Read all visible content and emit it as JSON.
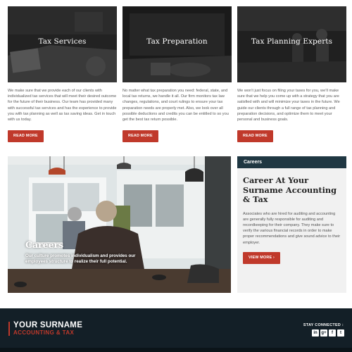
{
  "services": [
    {
      "title": "Tax Services",
      "text": "We make sure that we provide each of our clients with individualized tax services that will meet their desired outcome for the future of their business. Our team has provided many with successful tax services and has the experience to provide you with tax planning as well as tax saving ideas. Get in touch with us today.",
      "button": "READ MORE"
    },
    {
      "title": "Tax Preparation",
      "text": "No matter what tax preparation you need: federal, state, and local tax returns, we handle it all. Our firm monitors tax law changes, regulations, and court rulings to ensure your tax preparation needs are properly met. Also, we look over all possible deductions and credits you can be entitled to so you get the best tax return possible.",
      "button": "READ MORE"
    },
    {
      "title": "Tax Planning Experts",
      "text": "We won’t just focus on filing your taxes for you, we’ll make sure that we help you come up with a strategy that you are satisfied with and will minimize your taxes in the future. We guide our clients through a full range of tax planning and preparation decisions, and optimize them to meet your personal and business goals.",
      "button": "READ MORE"
    }
  ],
  "careers_feature": {
    "heading": "Careers",
    "text": "Our culture promotes individualism and provides our employees structure to realize their full potential."
  },
  "careers_panel": {
    "header": "Careers",
    "title": "Career At Your Surname Accounting & Tax",
    "text": "Associates who are hired for auditing and accounting are generally fully responsible for auditing and recordkeeping for their company. They make sure to verify the various financial records in order to make proper recommendations and give sound advice to their employer.",
    "button": "VIEW MORE ›"
  },
  "footer": {
    "logo_line1": "YOUR SURNAME",
    "logo_line2": "ACCOUNTING & TAX",
    "stay_connected": "STAY CONNECTED :",
    "social": [
      {
        "icon": "linkedin-icon",
        "glyph": "in"
      },
      {
        "icon": "google-plus-icon",
        "glyph": "g+"
      },
      {
        "icon": "facebook-icon",
        "glyph": "f"
      },
      {
        "icon": "twitter-icon",
        "glyph": "t"
      }
    ]
  },
  "colors": {
    "accent": "#c0392b",
    "panel_header": "#1f3742",
    "footer_bg": "#131f27"
  }
}
